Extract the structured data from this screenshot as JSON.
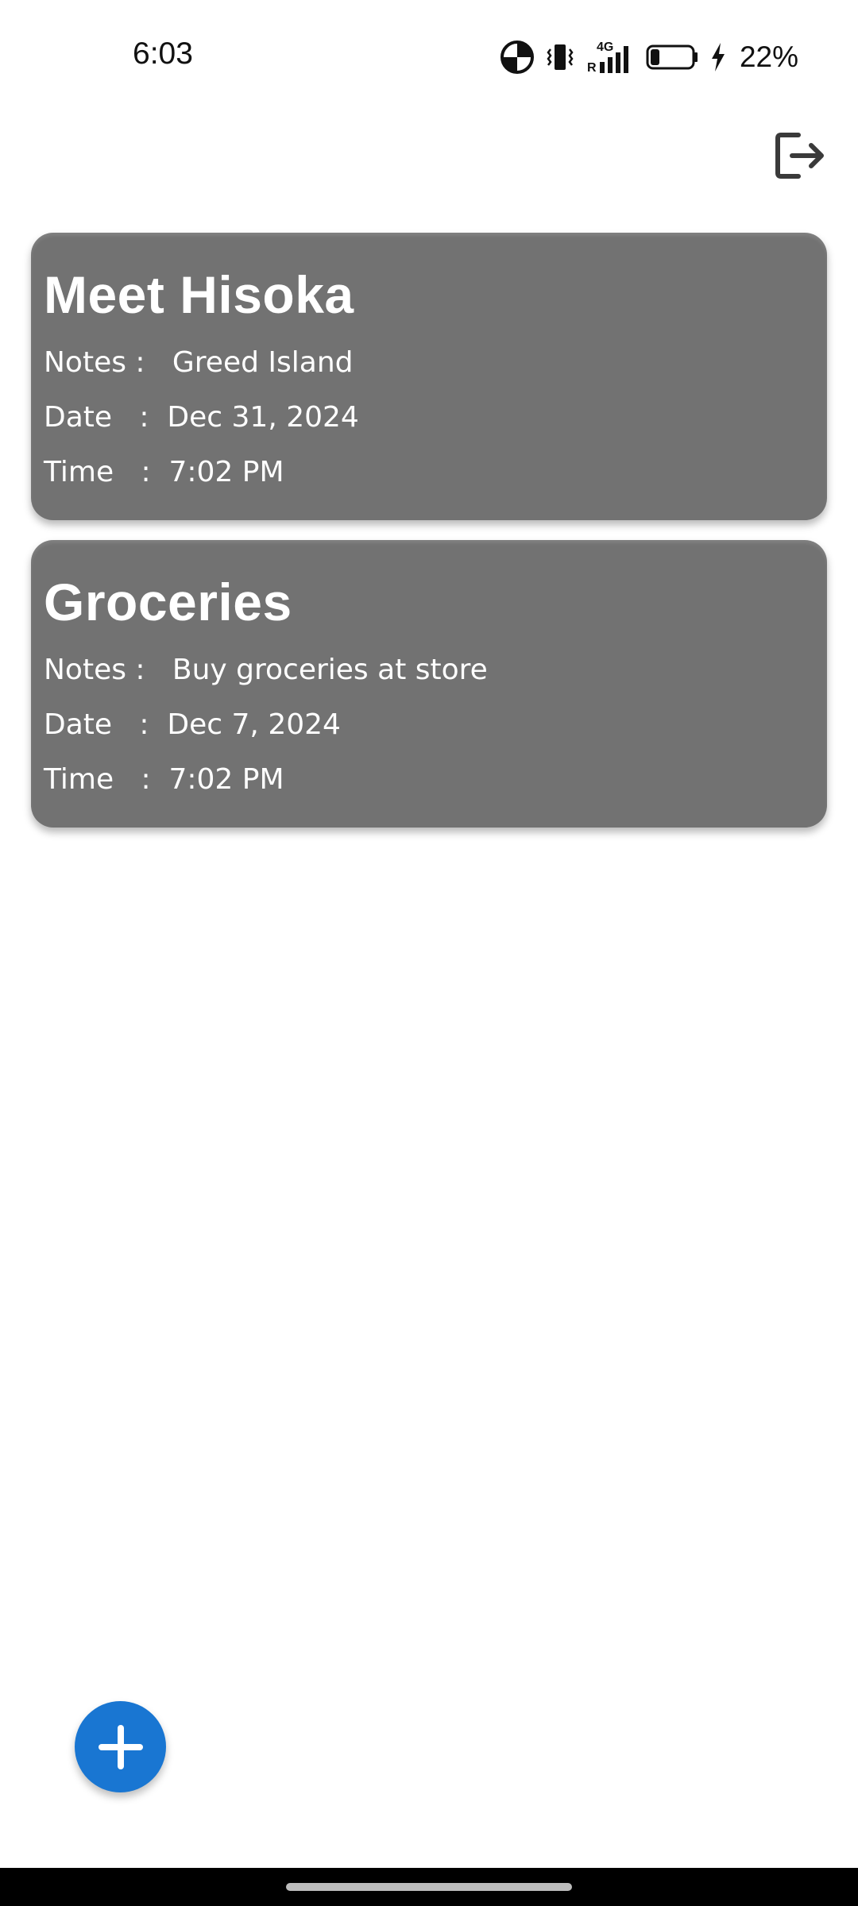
{
  "status_bar": {
    "time": "6:03",
    "battery_percent": "22%",
    "battery_level": 0.22,
    "network_label": "4G",
    "roaming_label": "R",
    "icons": [
      "data-saver-icon",
      "vibrate-icon",
      "signal-icon",
      "battery-icon",
      "charging-icon"
    ]
  },
  "header": {
    "logout_icon": "logout-icon"
  },
  "notes": [
    {
      "title": "Meet Hisoka",
      "notes_label": "Notes :",
      "notes_value": "Greed Island",
      "date_label": "Date",
      "date_sep": ":",
      "date_value": "Dec 31, 2024",
      "time_label": "Time",
      "time_sep": ":",
      "time_value": "7:02 PM"
    },
    {
      "title": "Groceries",
      "notes_label": "Notes :",
      "notes_value": "Buy groceries at store",
      "date_label": "Date",
      "date_sep": ":",
      "date_value": "Dec 7, 2024",
      "time_label": "Time",
      "time_sep": ":",
      "time_value": "7:02 PM"
    }
  ],
  "fab": {
    "icon": "plus-icon",
    "color": "#1976d2"
  },
  "colors": {
    "card_background": "#727272",
    "card_text": "#ffffff",
    "accent": "#1976d2"
  }
}
